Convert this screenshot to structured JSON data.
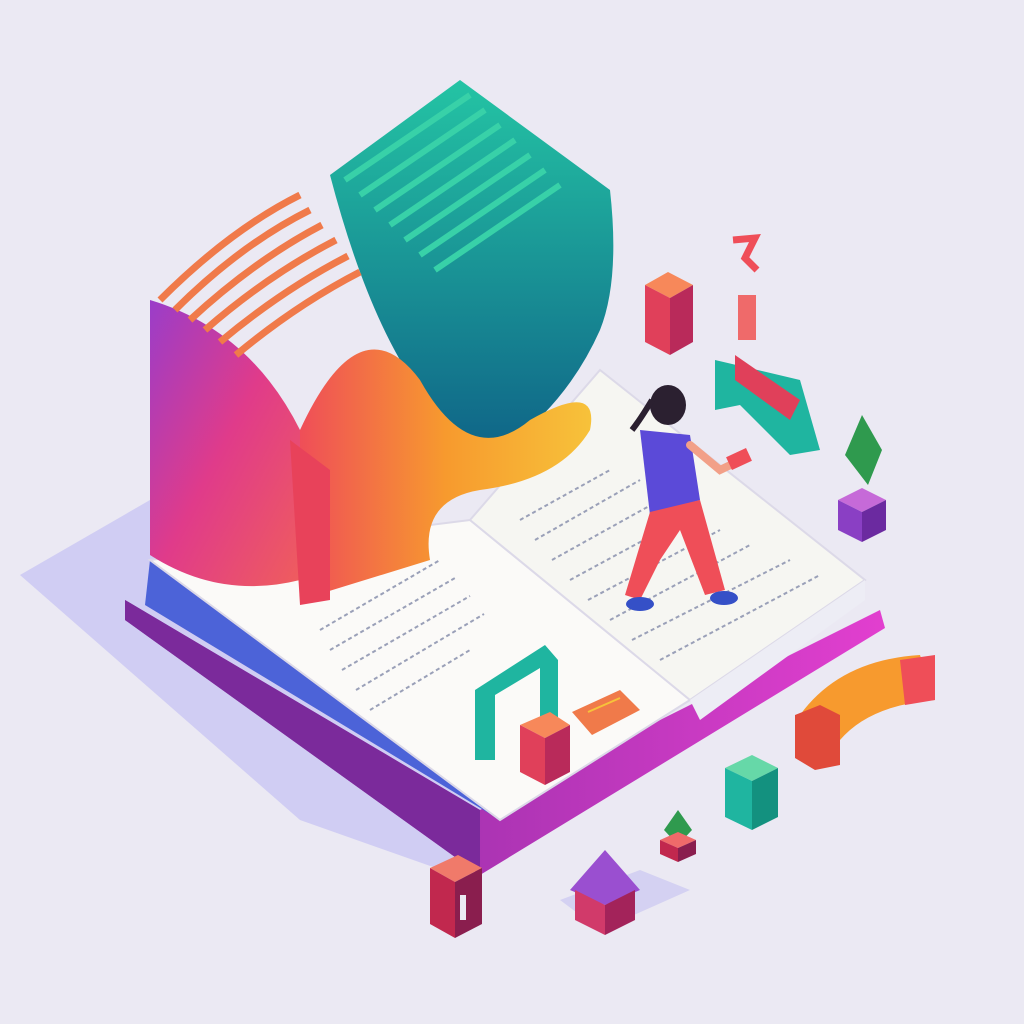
{
  "scene": {
    "subject": "isometric-open-book-illustration",
    "colors": {
      "background": "#ebe9f3",
      "shadow": "#c9c6f2",
      "book_cover_pink": "#e23fcf",
      "book_cover_purple": "#7b2a9b",
      "page_white": "#fbfaf8",
      "page_edge_blue": "#4c63d8",
      "teal": "#1fb5a0",
      "teal_dark": "#0f6d86",
      "orange": "#f79a2e",
      "coral": "#ef5d5d",
      "magenta": "#d13a8a",
      "purple": "#8a3fc4",
      "green": "#2f9a4e",
      "person_shirt": "#5b4ad8",
      "person_pants": "#ef4e58",
      "person_hair": "#2b2030"
    },
    "icons": [
      "open-book",
      "wave-sculpture",
      "person-reading",
      "cube",
      "tree",
      "house",
      "bracket",
      "arch",
      "handset"
    ]
  }
}
